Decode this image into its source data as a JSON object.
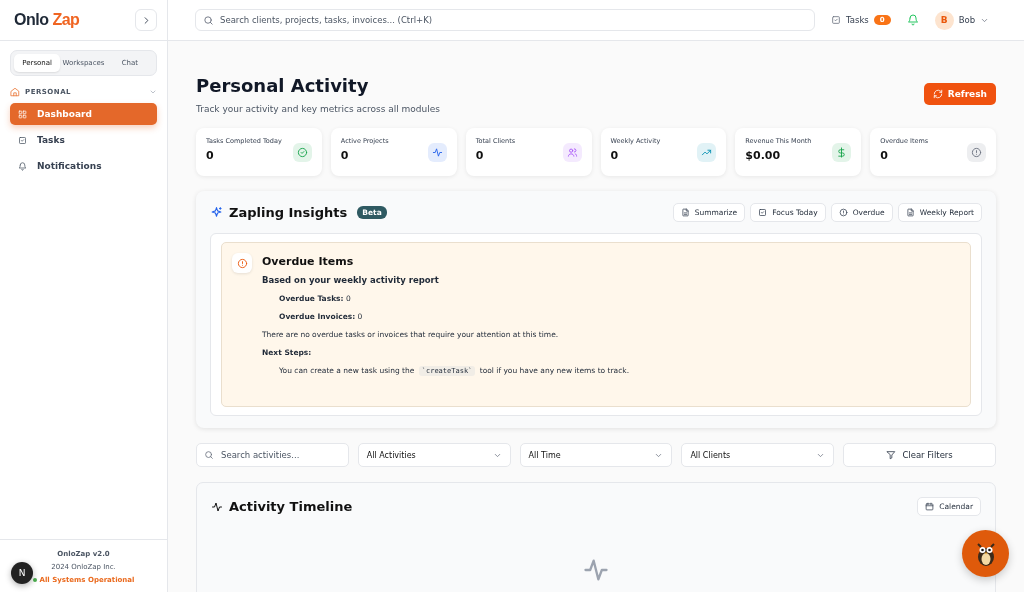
{
  "brand": {
    "first": "Onlo",
    "second": "Zap"
  },
  "sidebar": {
    "tabs": [
      {
        "label": "Personal",
        "selected": true
      },
      {
        "label": "Workspaces",
        "selected": false
      },
      {
        "label": "Chat",
        "selected": false
      }
    ],
    "section": {
      "label": "PERSONAL",
      "expanded": true
    },
    "items": [
      {
        "label": "Dashboard",
        "kind": "dashboard",
        "selected": true
      },
      {
        "label": "Tasks",
        "kind": "tasks",
        "selected": false
      },
      {
        "label": "Notifications",
        "kind": "notifications",
        "selected": false
      }
    ],
    "footer": {
      "version": "OnloZap v2.0",
      "copyright": "2024 OnloZap Inc.",
      "status": "All Systems Operational",
      "avatar": "N"
    }
  },
  "header": {
    "search_placeholder": "Search clients, projects, tasks, invoices... (Ctrl+K)",
    "tasks_label": "Tasks",
    "tasks_count": "0",
    "user_initial": "B",
    "user_name": "Bob"
  },
  "page": {
    "title": "Personal Activity",
    "subtitle": "Track your activity and key metrics across all modules",
    "refresh": "Refresh"
  },
  "stats": [
    {
      "label": "Tasks Completed Today",
      "value": "0",
      "kind": "check"
    },
    {
      "label": "Active Projects",
      "value": "0",
      "kind": "pulse"
    },
    {
      "label": "Total Clients",
      "value": "0",
      "kind": "users"
    },
    {
      "label": "Weekly Activity",
      "value": "0",
      "kind": "trend"
    },
    {
      "label": "Revenue This Month",
      "value": "$0.00",
      "kind": "dollar"
    },
    {
      "label": "Overdue Items",
      "value": "0",
      "kind": "alert"
    }
  ],
  "insights": {
    "title": "Zapling Insights",
    "badge": "Beta",
    "actions": [
      {
        "label": "Summarize",
        "kind": "doc"
      },
      {
        "label": "Focus Today",
        "kind": "check"
      },
      {
        "label": "Overdue",
        "kind": "alert"
      },
      {
        "label": "Weekly Report",
        "kind": "doc"
      }
    ],
    "result": {
      "title": "Overdue Items",
      "subtitle": "Based on your weekly activity report",
      "lines": [
        {
          "kind": "item",
          "text": "**Overdue Tasks:** 0"
        },
        {
          "kind": "item",
          "text": "**Overdue Invoices:** 0"
        },
        {
          "kind": "para",
          "text": "There are no overdue tasks or invoices that require your attention at this time."
        },
        {
          "kind": "para",
          "text": "**Next Steps:**"
        },
        {
          "kind": "code",
          "before": "You can create a new task using the",
          "code": "`createTask`",
          "after": "tool if you have any new items to track."
        }
      ]
    }
  },
  "filters": {
    "search_placeholder": "Search activities...",
    "selects": [
      "All Activities",
      "All Time",
      "All Clients"
    ],
    "clear": "Clear Filters"
  },
  "timeline": {
    "title": "Activity Timeline",
    "calendar": "Calendar"
  }
}
